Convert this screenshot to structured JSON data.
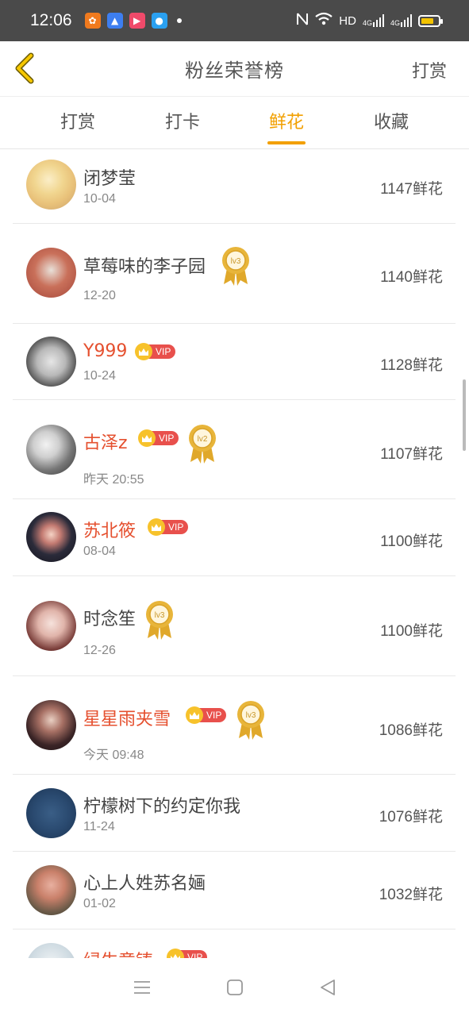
{
  "status": {
    "time": "12:06",
    "network": "HD",
    "signal1": "4G",
    "signal2": "4G",
    "battery_level": 0.75,
    "battery_color": "#f3c300"
  },
  "header": {
    "title": "粉丝荣誉榜",
    "action": "打赏"
  },
  "tabs": [
    {
      "label": "打赏",
      "active": false
    },
    {
      "label": "打卡",
      "active": false
    },
    {
      "label": "鲜花",
      "active": true
    },
    {
      "label": "收藏",
      "active": false
    }
  ],
  "accent_color": "#f2a000",
  "vip_label": "VIP",
  "rows": [
    {
      "name": "闭梦莹",
      "date": "10-04",
      "count": "1147鲜花",
      "vip": false,
      "medal": ""
    },
    {
      "name": "草莓味的李子园",
      "date": "12-20",
      "count": "1140鲜花",
      "vip": false,
      "medal": "lv3"
    },
    {
      "name": "Y999",
      "date": "10-24",
      "count": "1128鲜花",
      "vip": true,
      "medal": ""
    },
    {
      "name": "古泽z",
      "date": "昨天 20:55",
      "count": "1107鲜花",
      "vip": true,
      "medal": "lv2"
    },
    {
      "name": "苏北筱",
      "date": "08-04",
      "count": "1100鲜花",
      "vip": true,
      "medal": ""
    },
    {
      "name": "时念笙",
      "date": "12-26",
      "count": "1100鲜花",
      "vip": false,
      "medal": "lv3"
    },
    {
      "name": "星星雨夹雪",
      "date": "今天 09:48",
      "count": "1086鲜花",
      "vip": true,
      "medal": "lv3"
    },
    {
      "name": "柠檬树下的约定你我",
      "date": "11-24",
      "count": "1076鲜花",
      "vip": false,
      "medal": ""
    },
    {
      "name": "心上人姓苏名婳",
      "date": "01-02",
      "count": "1032鲜花",
      "vip": false,
      "medal": ""
    },
    {
      "name": "绿生意铸",
      "date": "",
      "count": "",
      "vip": true,
      "medal": ""
    }
  ]
}
